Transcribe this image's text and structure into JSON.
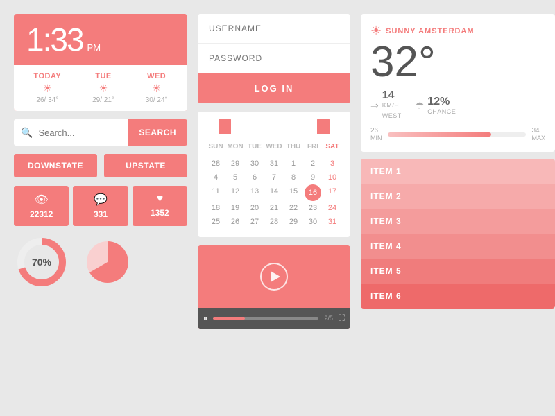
{
  "weather": {
    "time": "1:33",
    "ampm": "PM",
    "days": [
      {
        "label": "TODAY",
        "temp": "26/ 34°"
      },
      {
        "label": "TUE",
        "temp": "29/ 21°"
      },
      {
        "label": "WED",
        "temp": "30/ 24°"
      }
    ]
  },
  "search": {
    "placeholder": "Search...",
    "button_label": "SearCH"
  },
  "toggle_buttons": {
    "left": "DOWNSTATE",
    "right": "UPSTATE"
  },
  "stats": [
    {
      "icon": "👁",
      "value": "22312"
    },
    {
      "icon": "💬",
      "value": "331"
    },
    {
      "icon": "♥",
      "value": "1352"
    }
  ],
  "donut": {
    "percent": 70,
    "label": "70%"
  },
  "login": {
    "username_placeholder": "USERNAME",
    "password_placeholder": "PASSWORD",
    "button_label": "LOG IN"
  },
  "calendar": {
    "headers": [
      "SUN",
      "MON",
      "TUE",
      "WED",
      "THU",
      "FRI",
      "SAT"
    ],
    "rows": [
      [
        "28",
        "29",
        "30",
        "31",
        "1",
        "2",
        "3"
      ],
      [
        "4",
        "5",
        "6",
        "7",
        "8",
        "9",
        "10"
      ],
      [
        "11",
        "12",
        "13",
        "14",
        "15",
        "16",
        "17"
      ],
      [
        "18",
        "19",
        "20",
        "21",
        "22",
        "23",
        "24"
      ],
      [
        "25",
        "26",
        "27",
        "28",
        "29",
        "30",
        "31"
      ]
    ],
    "today_row": 2,
    "today_col": 5
  },
  "video": {
    "time": "2/5"
  },
  "amsterdam": {
    "city": "SUNNY AMSTERDAM",
    "temperature": "32°",
    "wind": {
      "value": "14",
      "unit": "KM/H",
      "direction": "WEST"
    },
    "rain": {
      "value": "12%",
      "label": "CHANCE"
    },
    "range_min": "26",
    "range_max": "34",
    "range_min_label": "MIN",
    "range_max_label": "MAX"
  },
  "items": [
    {
      "label": "ITEM 1",
      "color": "#f8b8b8"
    },
    {
      "label": "ITEM 2",
      "color": "#f6aaaa"
    },
    {
      "label": "ITEM 3",
      "color": "#f49c9c"
    },
    {
      "label": "ITEM 4",
      "color": "#f28e8e"
    },
    {
      "label": "ITEM 5",
      "color": "#f07c7c"
    },
    {
      "label": "ITEM 6",
      "color": "#ee6a6a"
    }
  ]
}
